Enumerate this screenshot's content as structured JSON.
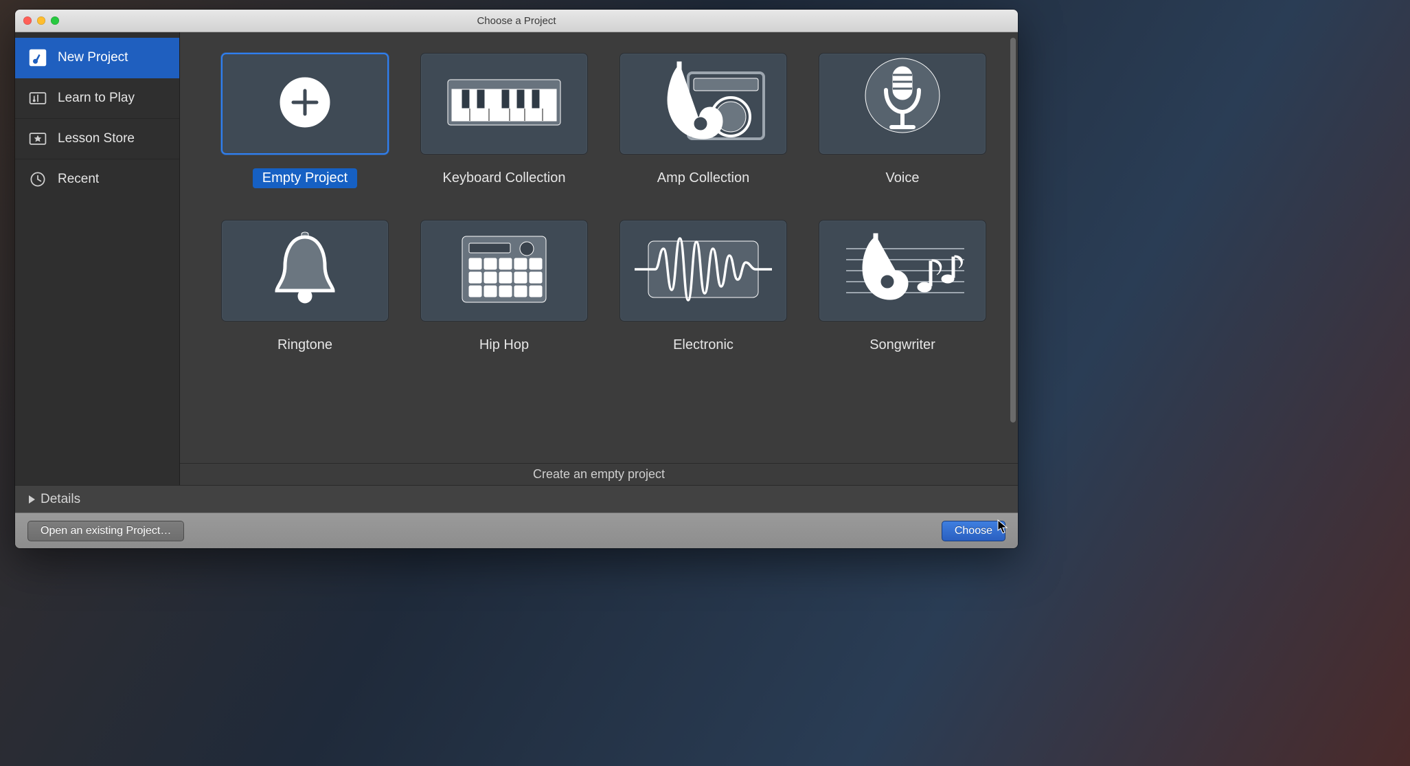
{
  "window": {
    "title": "Choose a Project"
  },
  "sidebar": {
    "items": [
      {
        "label": "New Project",
        "selected": true
      },
      {
        "label": "Learn to Play",
        "selected": false
      },
      {
        "label": "Lesson Store",
        "selected": false
      },
      {
        "label": "Recent",
        "selected": false
      }
    ]
  },
  "templates": [
    {
      "label": "Empty Project",
      "icon": "plus",
      "selected": true
    },
    {
      "label": "Keyboard Collection",
      "icon": "keyboard",
      "selected": false
    },
    {
      "label": "Amp Collection",
      "icon": "amp",
      "selected": false
    },
    {
      "label": "Voice",
      "icon": "mic",
      "selected": false
    },
    {
      "label": "Ringtone",
      "icon": "bell",
      "selected": false
    },
    {
      "label": "Hip Hop",
      "icon": "mpc",
      "selected": false
    },
    {
      "label": "Electronic",
      "icon": "wave",
      "selected": false
    },
    {
      "label": "Songwriter",
      "icon": "guitar",
      "selected": false
    }
  ],
  "status_text": "Create an empty project",
  "details": {
    "label": "Details"
  },
  "footer": {
    "open_label": "Open an existing Project…",
    "choose_label": "Choose"
  },
  "colors": {
    "accent": "#1f5fbf",
    "tile_bg": "#3f4a55",
    "window_bg": "#3c3c3c"
  }
}
